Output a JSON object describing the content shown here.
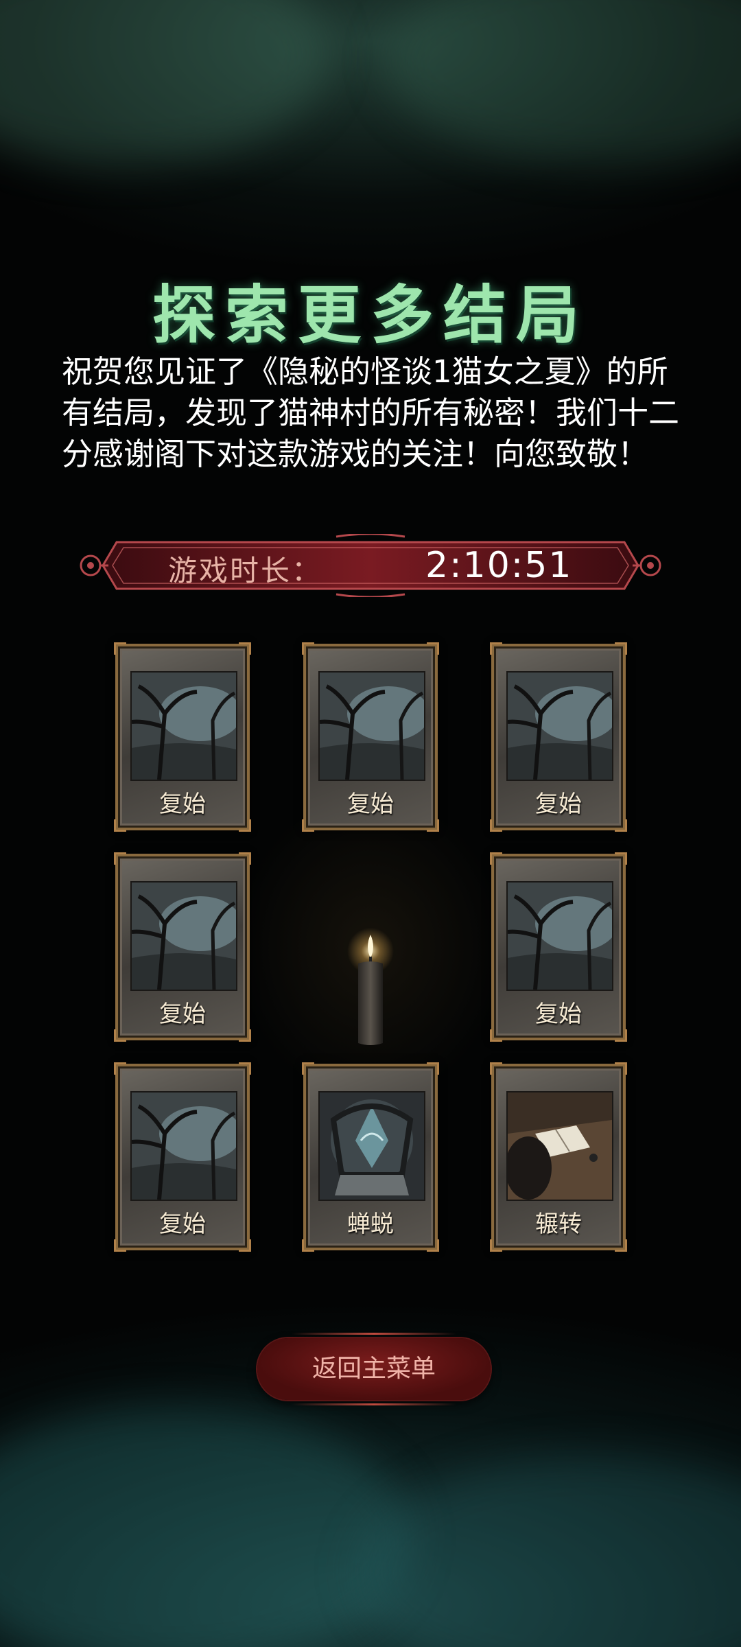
{
  "title": "探索更多结局",
  "message": "祝贺您见证了《隐秘的怪谈1猫女之夏》的所有结局，发现了猫神村的所有秘密！我们十二分感谢阁下对这款游戏的关注！向您致敬！",
  "playtime": {
    "label": "游戏时长：",
    "value": "2:10:51"
  },
  "endings": [
    {
      "label": "复始",
      "art": "forest"
    },
    {
      "label": "复始",
      "art": "forest"
    },
    {
      "label": "复始",
      "art": "forest"
    },
    {
      "label": "复始",
      "art": "forest"
    },
    {
      "label": "复始",
      "art": "forest"
    },
    {
      "label": "复始",
      "art": "forest"
    },
    {
      "label": "蝉蜕",
      "art": "throne"
    },
    {
      "label": "辗转",
      "art": "book-desk"
    }
  ],
  "return_button": "返回主菜单",
  "colors": {
    "title": "#9ee6ad",
    "banner": "#7a1b22",
    "button": "#5e1313",
    "frame": "#8a6a3e"
  }
}
